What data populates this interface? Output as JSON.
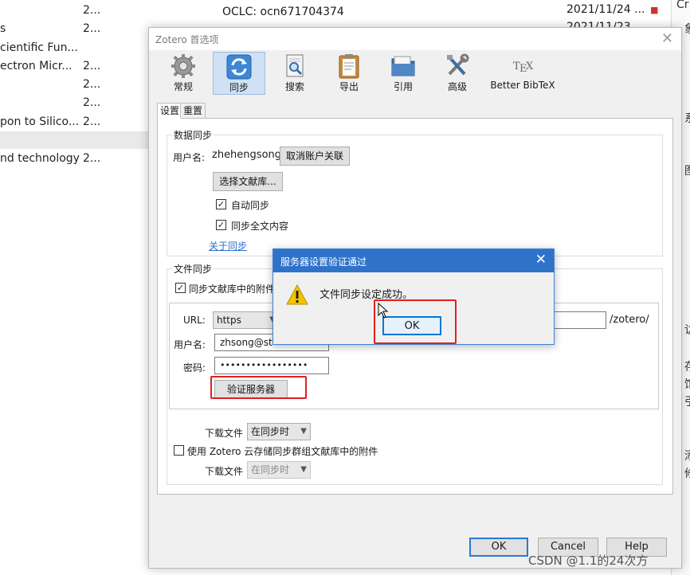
{
  "background": {
    "top_center": "OCLC: ocn671704374",
    "top_dates": [
      "2021/11/24 ...",
      "2021/11/23 ..."
    ],
    "rows": [
      {
        "title": "",
        "num": "2..."
      },
      {
        "title": "s",
        "num": "2..."
      },
      {
        "title": "cientific Fun...",
        "num": ""
      },
      {
        "title": "ectron Micr...",
        "num": "2..."
      },
      {
        "title": "",
        "num": "2..."
      },
      {
        "title": "",
        "num": "2..."
      },
      {
        "title": "pon to Silico...",
        "num": "2..."
      },
      {
        "title": "",
        "num": ""
      },
      {
        "title": "nd technology",
        "num": "2..."
      }
    ],
    "right_panel_chars": [
      "Cr",
      "象",
      "系",
      "图",
      "访",
      "存",
      "馆",
      "引",
      "添",
      "修"
    ]
  },
  "prefs": {
    "title": "Zotero 首选项",
    "toolbar": [
      {
        "label": "常规",
        "icon": "gear-icon"
      },
      {
        "label": "同步",
        "icon": "sync-icon"
      },
      {
        "label": "搜索",
        "icon": "search-icon"
      },
      {
        "label": "导出",
        "icon": "clipboard-icon"
      },
      {
        "label": "引用",
        "icon": "folder-icon"
      },
      {
        "label": "高级",
        "icon": "tools-icon"
      },
      {
        "label": "Better BibTeX",
        "icon": "tex-icon"
      }
    ],
    "tabs": [
      "设置",
      "重置"
    ],
    "data_sync": {
      "title": "数据同步",
      "username_label": "用户名:",
      "username": "zhehengsong",
      "unlink_button": "取消账户关联",
      "choose_library_button": "选择文献库...",
      "auto_sync": "自动同步",
      "sync_fulltext": "同步全文内容",
      "about_link": "关于同步"
    },
    "file_sync": {
      "title": "文件同步",
      "sync_attachments": "同步文献库中的附件",
      "url_label": "URL:",
      "url_scheme": "https",
      "url_suffix": "/zotero/",
      "username_label": "用户名:",
      "username": "zhsong@st",
      "password_label": "密码:",
      "password": "•••••••••••••••••",
      "verify_button": "验证服务器",
      "download_label": "下载文件",
      "download_value": "在同步时",
      "group_sync": "使用 Zotero 云存储同步群组文献库中的附件",
      "group_download_label": "下载文件",
      "group_download_value": "在同步时"
    },
    "footer": {
      "ok": "OK",
      "cancel": "Cancel",
      "help": "Help"
    }
  },
  "alert": {
    "title": "服务器设置验证通过",
    "message": "文件同步设定成功。",
    "ok": "OK"
  },
  "watermark": "CSDN @1.1的24次方",
  "colors": {
    "accent": "#2f73c9",
    "highlight": "#e02020",
    "active_tab": "#cfe1f3"
  }
}
